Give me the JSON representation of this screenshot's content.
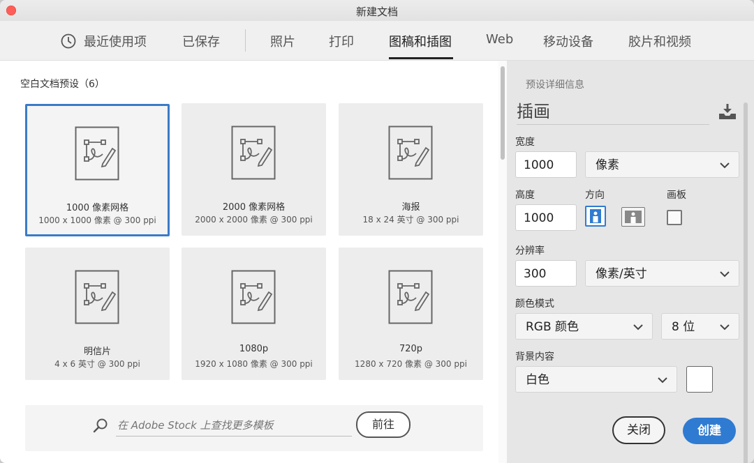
{
  "window": {
    "title": "新建文档"
  },
  "tabs": [
    {
      "label": "最近使用项",
      "active": false
    },
    {
      "label": "已保存",
      "active": false
    },
    {
      "label": "照片",
      "active": false
    },
    {
      "label": "打印",
      "active": false
    },
    {
      "label": "图稿和插图",
      "active": true
    },
    {
      "label": "Web",
      "active": false
    },
    {
      "label": "移动设备",
      "active": false
    },
    {
      "label": "胶片和视频",
      "active": false
    }
  ],
  "presets": {
    "section_title": "空白文档预设（6）",
    "items": [
      {
        "name": "1000 像素网格",
        "meta": "1000 x 1000 像素 @ 300 ppi",
        "selected": true
      },
      {
        "name": "2000 像素网格",
        "meta": "2000 x 2000 像素 @ 300 ppi",
        "selected": false
      },
      {
        "name": "海报",
        "meta": "18 x 24 英寸 @ 300 ppi",
        "selected": false
      },
      {
        "name": "明信片",
        "meta": "4 x 6 英寸 @ 300 ppi",
        "selected": false
      },
      {
        "name": "1080p",
        "meta": "1920 x 1080 像素 @ 300 ppi",
        "selected": false
      },
      {
        "name": "720p",
        "meta": "1280 x 720 像素 @ 300 ppi",
        "selected": false
      }
    ]
  },
  "stock": {
    "placeholder": "在 Adobe Stock 上查找更多模板",
    "go_label": "前往"
  },
  "details": {
    "heading": "预设详细信息",
    "preset_name": "插画",
    "width_label": "宽度",
    "width_value": "1000",
    "width_unit": "像素",
    "height_label": "高度",
    "height_value": "1000",
    "orientation_label": "方向",
    "artboard_label": "画板",
    "resolution_label": "分辨率",
    "resolution_value": "300",
    "resolution_unit": "像素/英寸",
    "color_mode_label": "颜色模式",
    "color_mode": "RGB 颜色",
    "bit_depth": "8 位",
    "background_label": "背景内容",
    "background_value": "白色",
    "close_label": "关闭",
    "create_label": "创建"
  },
  "colors": {
    "accent": "#2f7bd2",
    "selected_border": "#3a7bc8",
    "close_dot": "#fd5e57"
  }
}
